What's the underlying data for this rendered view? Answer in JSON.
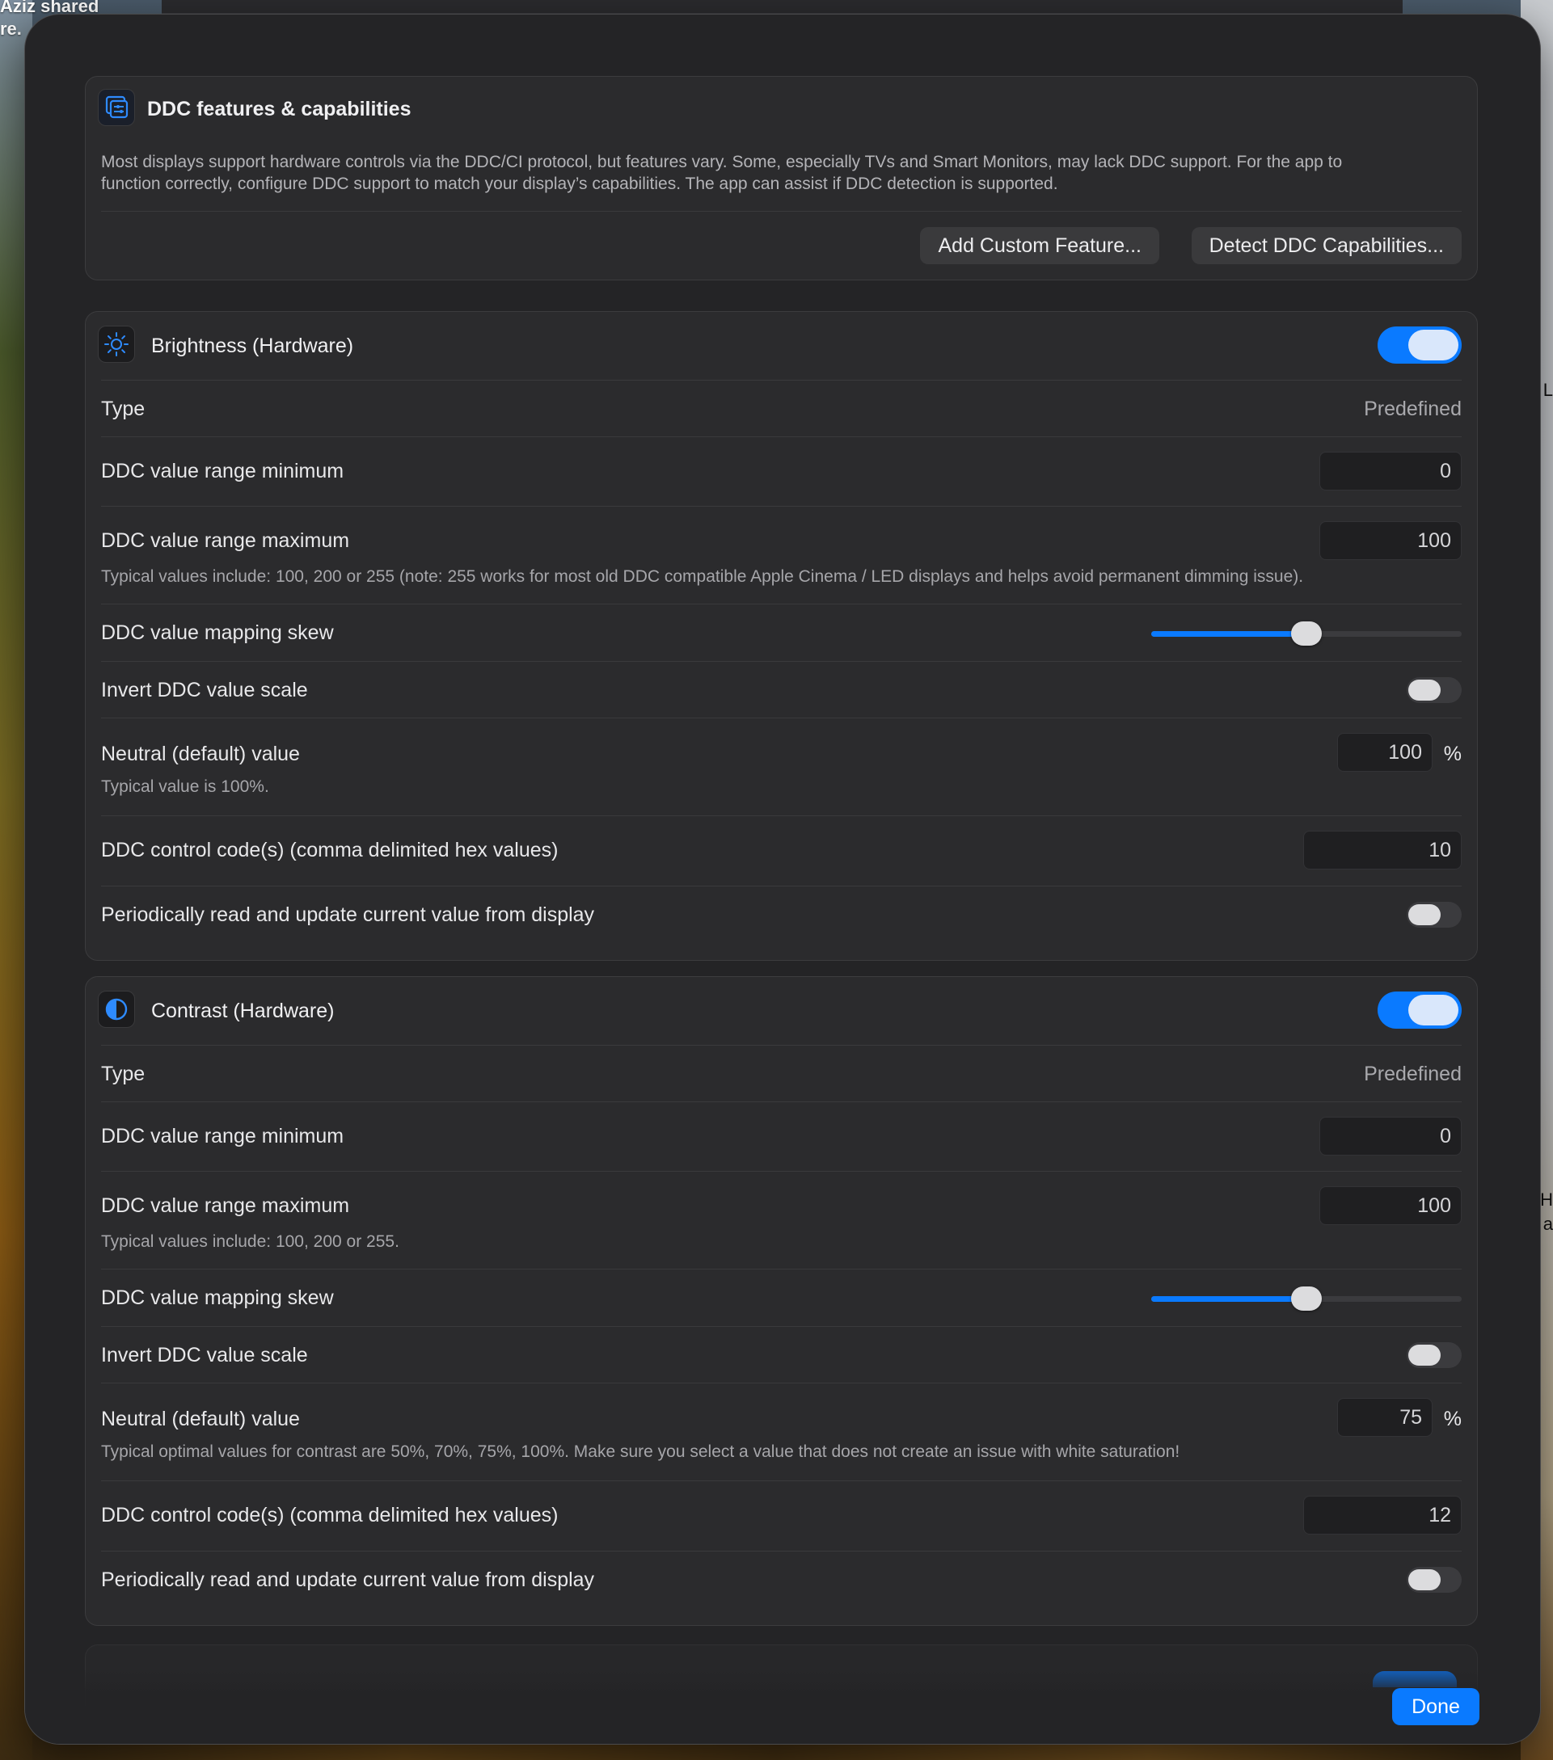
{
  "background": {
    "top_left_text": [
      "Aziz shared",
      "re."
    ],
    "right_glyphs": [
      "L",
      "H",
      "a"
    ]
  },
  "ddc_features": {
    "title": "DDC features & capabilities",
    "description_line1": "Most displays support hardware controls via the DDC/CI protocol, but features vary. Some, especially TVs and Smart Monitors, may lack DDC support. For the app to",
    "description_line2": "function correctly, configure DDC support to match your display’s capabilities. The app can assist if DDC detection is supported.",
    "add_custom_label": "Add Custom Feature...",
    "detect_label": "Detect DDC Capabilities..."
  },
  "brightness": {
    "title": "Brightness (Hardware)",
    "enabled": true,
    "type_label": "Type",
    "type_value": "Predefined",
    "min_label": "DDC value range minimum",
    "min_value": "0",
    "max_label": "DDC value range maximum",
    "max_value": "100",
    "max_note": "Typical values include: 100, 200 or 255 (note: 255 works for most old DDC compatible Apple Cinema / LED displays and helps avoid permanent dimming issue).",
    "skew_label": "DDC value mapping skew",
    "skew_fraction": 0.5,
    "invert_label": "Invert DDC value scale",
    "invert_on": false,
    "neutral_label": "Neutral (default) value",
    "neutral_value": "100",
    "neutral_unit": "%",
    "neutral_note": "Typical value is 100%.",
    "codes_label": "DDC control code(s) (comma delimited hex values)",
    "codes_value": "10",
    "periodic_label": "Periodically read and update current value from display",
    "periodic_on": false
  },
  "contrast": {
    "title": "Contrast (Hardware)",
    "enabled": true,
    "type_label": "Type",
    "type_value": "Predefined",
    "min_label": "DDC value range minimum",
    "min_value": "0",
    "max_label": "DDC value range maximum",
    "max_value": "100",
    "max_note": "Typical values include: 100, 200 or 255.",
    "skew_label": "DDC value mapping skew",
    "skew_fraction": 0.5,
    "invert_label": "Invert DDC value scale",
    "invert_on": false,
    "neutral_label": "Neutral (default) value",
    "neutral_value": "75",
    "neutral_unit": "%",
    "neutral_note": "Typical optimal values for contrast are 50%, 70%, 75%, 100%. Make sure you select a value that does not create an issue with white saturation!",
    "codes_label": "DDC control code(s) (comma delimited hex values)",
    "codes_value": "12",
    "periodic_label": "Periodically read and update current value from display",
    "periodic_on": false
  },
  "footer": {
    "done_label": "Done"
  },
  "colors": {
    "accent": "#0a7aff",
    "sheet_bg": "#242426",
    "card_bg": "#2b2b2d"
  }
}
